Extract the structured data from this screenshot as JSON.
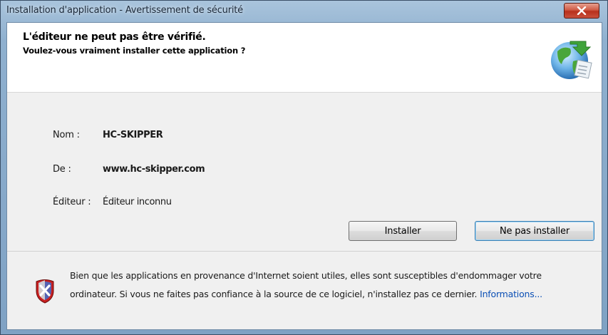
{
  "window": {
    "title": "Installation d'application - Avertissement de sécurité",
    "close_label": "x"
  },
  "header": {
    "main_instruction": "L'éditeur ne peut pas être vérifié.",
    "sub_instruction": "Voulez-vous vraiment installer cette application ?",
    "icon": "globe-app-icon"
  },
  "info": {
    "name_label": "Nom :",
    "name_value": "HC-SKIPPER",
    "from_label": "De :",
    "from_value": "www.hc-skipper.com",
    "publisher_label": "Éditeur :",
    "publisher_value": "Éditeur inconnu"
  },
  "buttons": {
    "install_label": "Installer",
    "no_install_label": "Ne pas installer"
  },
  "footer": {
    "icon": "security-shield-icon",
    "text": "Bien que les applications en provenance d'Internet soient utiles, elles sont susceptibles d'endommager votre ordinateur. Si vous ne faites pas confiance à la source de ce logiciel, n'installez pas ce dernier.",
    "link": "Informations..."
  },
  "colors": {
    "frame": "#8fb0cf",
    "close_button": "#c9503c",
    "link": "#0b4fb5"
  }
}
